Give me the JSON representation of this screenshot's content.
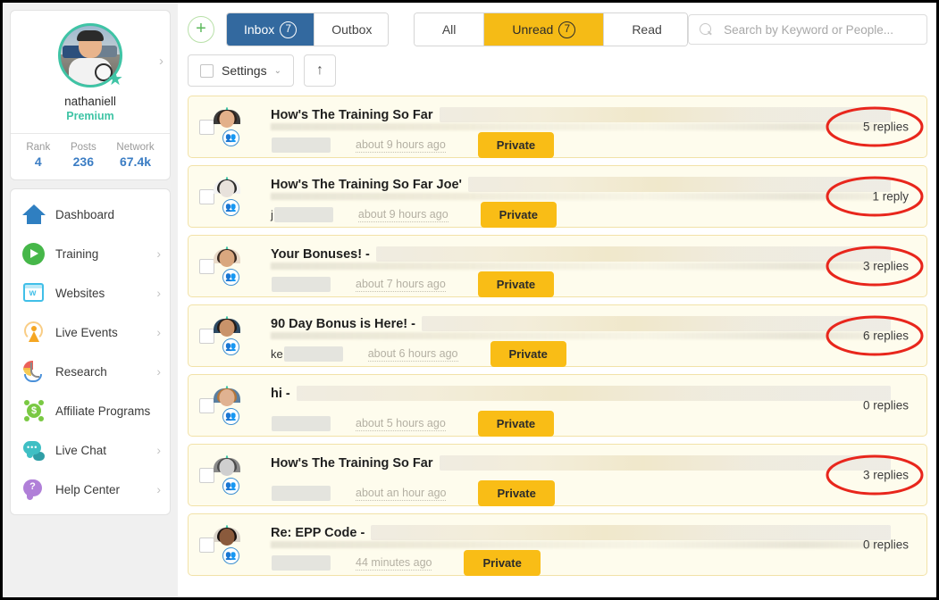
{
  "sidebar": {
    "profile": {
      "name": "nathaniell",
      "tier": "Premium",
      "chevron": "›",
      "star_icon": "★",
      "stats": [
        {
          "label": "Rank",
          "value": "4"
        },
        {
          "label": "Posts",
          "value": "236"
        },
        {
          "label": "Network",
          "value": "67.4k"
        }
      ]
    },
    "nav": [
      {
        "label": "Dashboard",
        "icon": "house-icon",
        "chevron": ""
      },
      {
        "label": "Training",
        "icon": "play-icon",
        "chevron": "›"
      },
      {
        "label": "Websites",
        "icon": "websites-icon",
        "chevron": "›"
      },
      {
        "label": "Live Events",
        "icon": "antenna-icon",
        "chevron": "›"
      },
      {
        "label": "Research",
        "icon": "research-icon",
        "chevron": "›"
      },
      {
        "label": "Affiliate Programs",
        "icon": "affiliate-icon",
        "chevron": ""
      },
      {
        "label": "Live Chat",
        "icon": "chat-icon",
        "chevron": "›"
      },
      {
        "label": "Help Center",
        "icon": "help-icon",
        "chevron": "›"
      }
    ],
    "icon_glyphs": {
      "websites_letter": "w",
      "affiliate_letter": "$",
      "help_letter": "?",
      "chat_dots": "•••"
    }
  },
  "toolbar": {
    "compose_label": "+",
    "mailbox_tabs": [
      {
        "label": "Inbox",
        "count": "7",
        "active": true
      },
      {
        "label": "Outbox",
        "count": "",
        "active": false
      }
    ],
    "filter_tabs": [
      {
        "label": "All",
        "count": "",
        "active": false
      },
      {
        "label": "Unread",
        "count": "7",
        "active": true
      },
      {
        "label": "Read",
        "count": "",
        "active": false
      }
    ],
    "search": {
      "placeholder": "Search by Keyword or People...",
      "value": "",
      "icon": "search-icon"
    },
    "settings_label": "Settings",
    "settings_caret": "⌄",
    "up_arrow": "↑"
  },
  "messages": [
    {
      "subject": "How's The Training So Far",
      "dash": "",
      "username": "",
      "time": "about 9 hours ago",
      "privacy": "Private",
      "replies": "5 replies",
      "circled": true,
      "avatar": {
        "bg": "#6f5b4a",
        "skin": "#e3b08a",
        "hair": "#2c1f18",
        "shirt": "#3b3b3b"
      }
    },
    {
      "subject": "How's The Training So Far Joe'",
      "dash": "",
      "username": "j",
      "time": "about 9 hours ago",
      "privacy": "Private",
      "replies": "1 reply",
      "circled": true,
      "avatar": {
        "bg": "#cfcfcf",
        "skin": "#e8e2dc",
        "hair": "#2a2a2a",
        "shirt": "#f2f2f2"
      }
    },
    {
      "subject": "Your Bonuses!",
      "dash": "-",
      "username": "",
      "time": "about 7 hours ago",
      "privacy": "Private",
      "replies": "3 replies",
      "circled": true,
      "avatar": {
        "bg": "#b8c4cc",
        "skin": "#d9a77f",
        "hair": "#3a2a20",
        "shirt": "#e8d9c8"
      }
    },
    {
      "subject": "90 Day Bonus is Here!",
      "dash": "-",
      "username": "ke",
      "time": "about 6 hours ago",
      "privacy": "Private",
      "replies": "6 replies",
      "circled": true,
      "avatar": {
        "bg": "#4a6d8c",
        "skin": "#c9936a",
        "hair": "#241a14",
        "shirt": "#2d4a63"
      }
    },
    {
      "subject": "hi",
      "dash": "-",
      "username": "",
      "time": "about 5 hours ago",
      "privacy": "Private",
      "replies": "0 replies",
      "circled": false,
      "avatar": {
        "bg": "#9ab0c4",
        "skin": "#e0b291",
        "hair": "#b4763a",
        "shirt": "#5a7fa0"
      }
    },
    {
      "subject": "How's The Training So Far",
      "dash": "",
      "username": "",
      "time": "about an hour ago",
      "privacy": "Private",
      "replies": "3 replies",
      "circled": true,
      "avatar": {
        "bg": "#d8d8d8",
        "skin": "#cfcfcf",
        "hair": "#4a4a4a",
        "shirt": "#8a8a8a"
      }
    },
    {
      "subject": "Re: EPP Code",
      "dash": "-",
      "username": "",
      "time": "44 minutes ago",
      "privacy": "Private",
      "replies": "0 replies",
      "circled": false,
      "avatar": {
        "bg": "#7a9ab0",
        "skin": "#8a5a3c",
        "hair": "#1a1210",
        "shirt": "#d8d2c8"
      }
    }
  ],
  "colors": {
    "accent_blue": "#33699f",
    "accent_amber": "#f5bb16",
    "teal_ring": "#3fc4a5",
    "row_bg": "#fefced",
    "row_border": "#f2e2a8",
    "annotation_red": "#e8261c",
    "stat_blue": "#3b7dc4"
  }
}
